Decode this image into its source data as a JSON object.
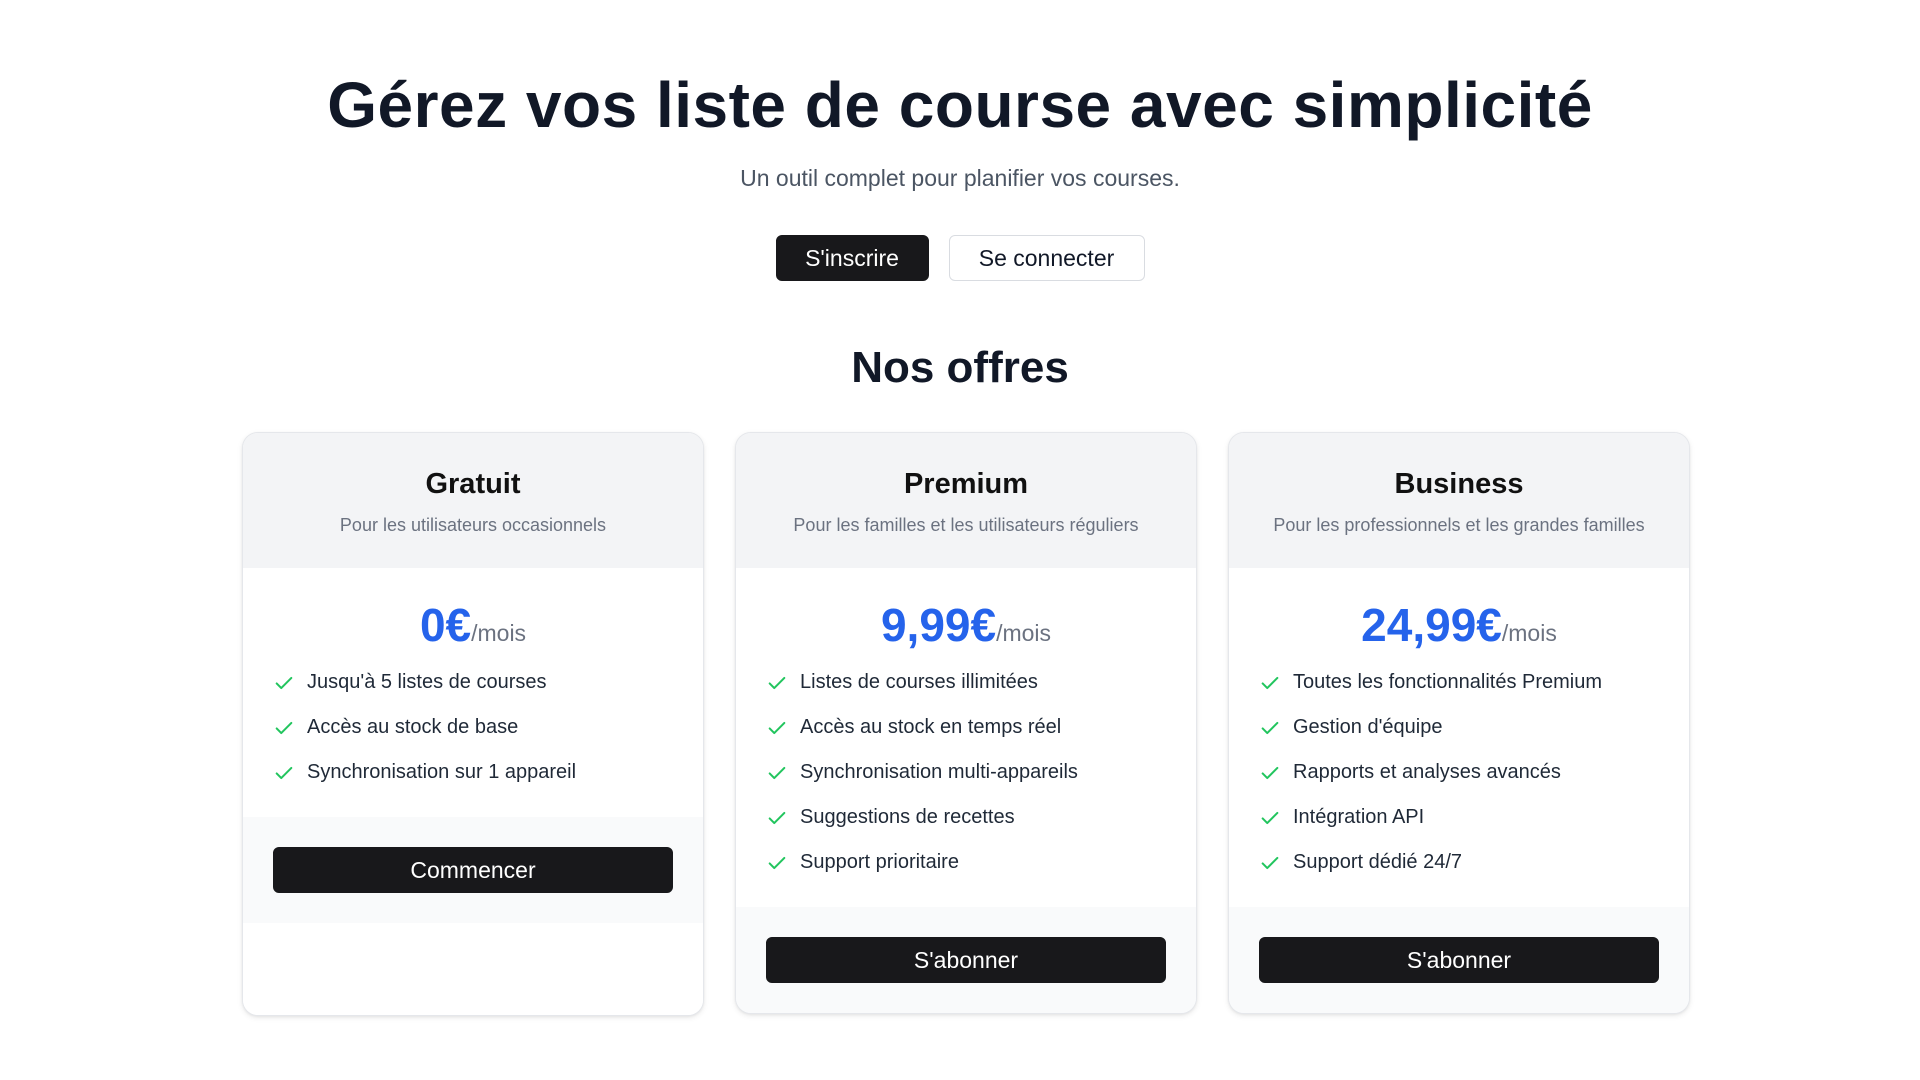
{
  "hero": {
    "title": "Gérez vos liste de course avec simplicité",
    "subtitle": "Un outil complet pour planifier vos courses.",
    "signup_label": "S'inscrire",
    "login_label": "Se connecter"
  },
  "offers": {
    "title": "Nos offres",
    "accent_color": "#2563eb",
    "check_color": "#22c55e",
    "plans": [
      {
        "name": "Gratuit",
        "description": "Pour les utilisateurs occasionnels",
        "price": "0€",
        "period": "/mois",
        "features": [
          "Jusqu'à 5 listes de courses",
          "Accès au stock de base",
          "Synchronisation sur 1 appareil"
        ],
        "button_label": "Commencer"
      },
      {
        "name": "Premium",
        "description": "Pour les familles et les utilisateurs réguliers",
        "price": "9,99€",
        "period": "/mois",
        "features": [
          "Listes de courses illimitées",
          "Accès au stock en temps réel",
          "Synchronisation multi-appareils",
          "Suggestions de recettes",
          "Support prioritaire"
        ],
        "button_label": "S'abonner"
      },
      {
        "name": "Business",
        "description": "Pour les professionnels et les grandes familles",
        "price": "24,99€",
        "period": "/mois",
        "features": [
          "Toutes les fonctionnalités Premium",
          "Gestion d'équipe",
          "Rapports et analyses avancés",
          "Intégration API",
          "Support dédié 24/7"
        ],
        "button_label": "S'abonner"
      }
    ]
  }
}
